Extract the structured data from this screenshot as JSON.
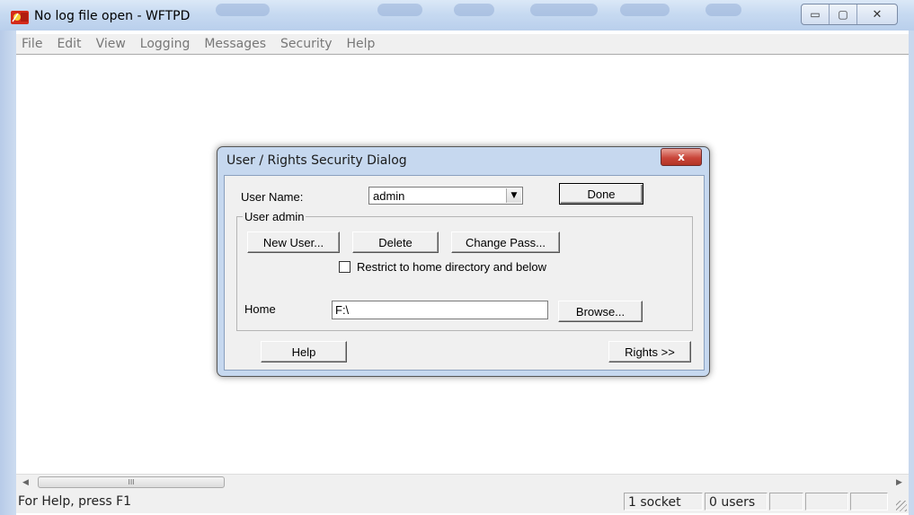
{
  "window": {
    "title": "No log file open - WFTPD"
  },
  "menu": [
    "File",
    "Edit",
    "View",
    "Logging",
    "Messages",
    "Security",
    "Help"
  ],
  "dialog": {
    "title": "User / Rights Security Dialog",
    "close_label": "x",
    "user_name_label": "User Name:",
    "user_name_value": "admin",
    "done_label": "Done",
    "group_label": "User admin",
    "new_user_label": "New User...",
    "delete_label": "Delete",
    "change_pass_label": "Change Pass...",
    "restrict_label": "Restrict to home directory and below",
    "restrict_checked": false,
    "home_label": "Home",
    "home_value": "F:\\",
    "browse_label": "Browse...",
    "help_label": "Help",
    "rights_label": "Rights >>"
  },
  "scrollbar": {
    "thumb_glyph": "III"
  },
  "status": {
    "help_text": "For Help, press F1",
    "sockets": "1 socket",
    "users": "0 users"
  }
}
